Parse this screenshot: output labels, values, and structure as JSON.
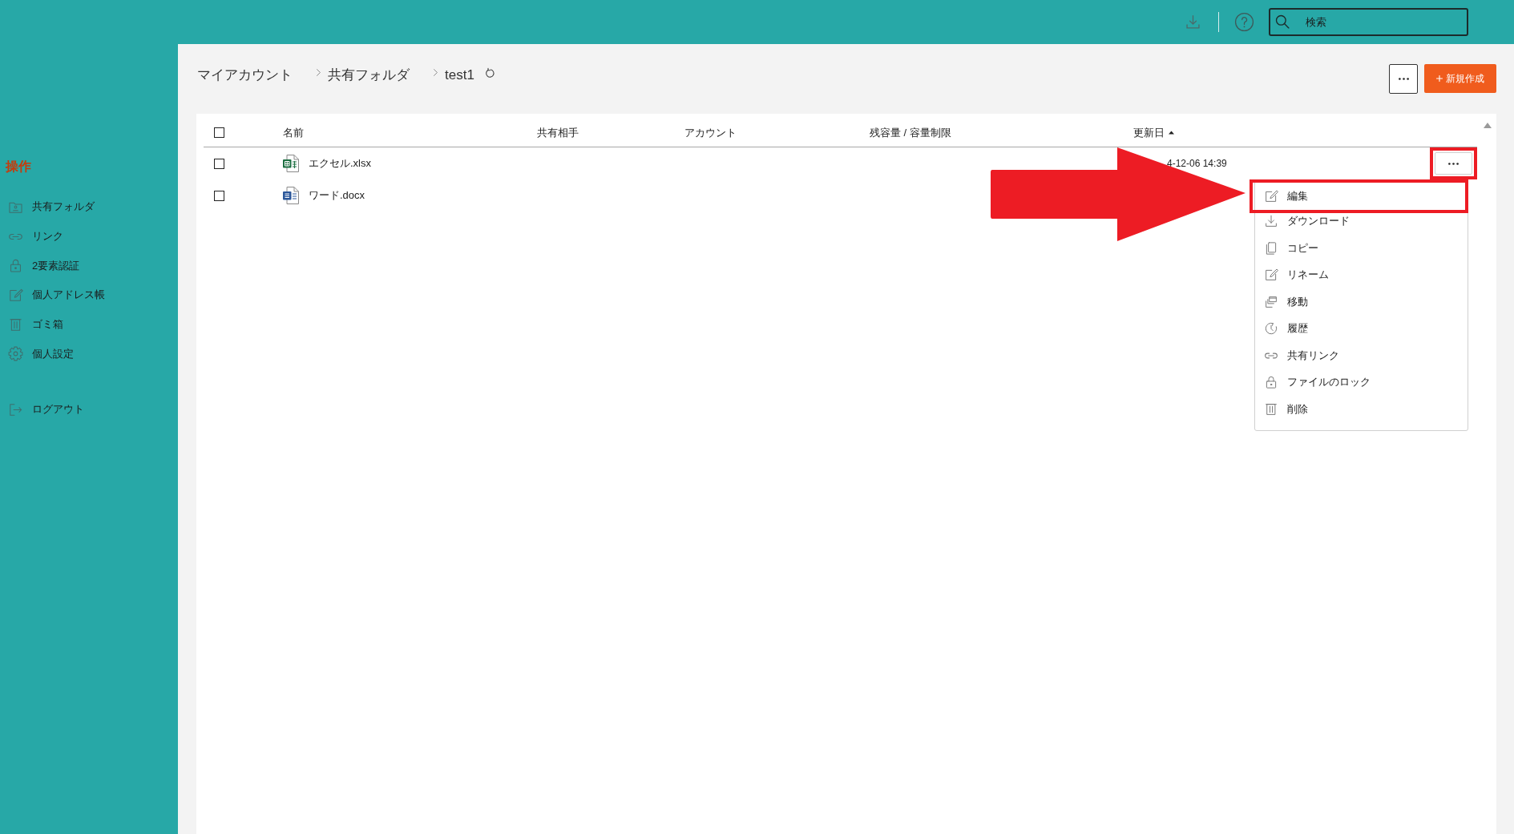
{
  "top_bar": {
    "search": {
      "placeholder": "検索"
    }
  },
  "sidebar": {
    "title": "操作",
    "items": [
      {
        "label": "共有フォルダ"
      },
      {
        "label": "リンク"
      },
      {
        "label": "2要素認証"
      },
      {
        "label": "個人アドレス帳"
      },
      {
        "label": "ゴミ箱"
      },
      {
        "label": "個人設定"
      }
    ],
    "logout": {
      "label": "ログアウト"
    }
  },
  "breadcrumb": [
    {
      "label": "マイアカウント"
    },
    {
      "label": "共有フォルダ"
    },
    {
      "label": "test1"
    }
  ],
  "toolbar": {
    "new_button": {
      "label": "新規作成"
    }
  },
  "table": {
    "select_all_checked": false,
    "columns": [
      {
        "label": "名前",
        "sorted": false
      },
      {
        "label": "共有相手",
        "sorted": false
      },
      {
        "label": "アカウント",
        "sorted": false
      },
      {
        "label": "残容量 / 容量制限",
        "sorted": false
      },
      {
        "label": "更新日",
        "sorted": true
      }
    ],
    "rows": [
      {
        "kind": "spreadsheet",
        "name": "エクセル.xlsx",
        "modified": "4-12-06 14:39",
        "checked": false,
        "hovered": true,
        "marked": true
      },
      {
        "kind": "document",
        "name": "ワード.docx",
        "checked": false,
        "hovered": false,
        "marked": false
      }
    ]
  },
  "context_menu": {
    "items": [
      {
        "label": "編集",
        "marked": true
      },
      {
        "label": "ダウンロード",
        "marked": false
      },
      {
        "label": "コピー",
        "marked": false
      },
      {
        "label": "リネーム",
        "marked": false
      },
      {
        "label": "移動",
        "marked": false
      },
      {
        "label": "履歴",
        "marked": false
      },
      {
        "label": "共有リンク",
        "marked": false
      },
      {
        "label": "ファイルのロック",
        "marked": false
      },
      {
        "label": "削除",
        "marked": false
      }
    ]
  }
}
